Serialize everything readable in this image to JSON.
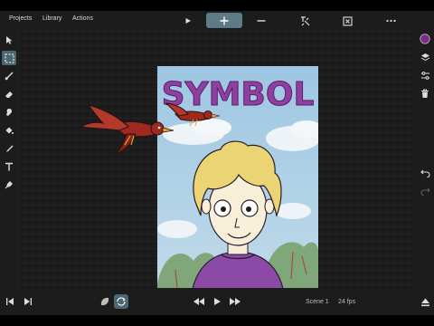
{
  "menu": {
    "projects": "Projects",
    "library": "Library",
    "actions": "Actions"
  },
  "toolbar": {
    "play": "play-icon",
    "add": "plus-icon",
    "remove": "minus-icon",
    "onion": "onion-skin-icon",
    "frame": "frame-fit-icon",
    "more": "more-icon"
  },
  "tools": [
    "pointer-icon",
    "selection-icon",
    "brush-icon",
    "eraser-icon",
    "smudge-icon",
    "fill-icon",
    "eyedropper-icon",
    "text-icon",
    "pen-icon"
  ],
  "right_tools": {
    "color_swatch": "#7d2a8c",
    "items": [
      "color-swatch-icon",
      "layers-icon",
      "adjust-icon",
      "trash-icon",
      "undo-icon",
      "redo-icon"
    ]
  },
  "canvas_art": {
    "title": "SYMBOL",
    "title_color": "#8e3fa0"
  },
  "bottom": {
    "scene": "Scene 1",
    "fps": "24 fps"
  },
  "colors": {
    "accent": "#5e7a86",
    "panel": "#1c1c1c",
    "workspace": "#1b1b1b"
  }
}
